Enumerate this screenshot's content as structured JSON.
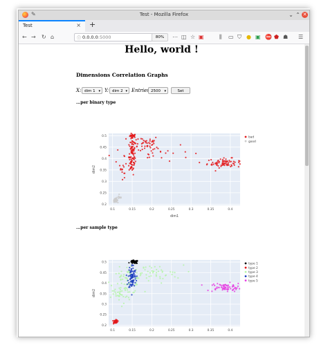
{
  "browser": {
    "window_title": "Test - Mozilla Firefox",
    "tab_label": "Test",
    "url_host": "0.0.0.0",
    "url_port": ":5000",
    "zoom": "80%"
  },
  "page": {
    "heading": "Hello, world !",
    "section_title": "Dimensions Correlation Graphs",
    "controls": {
      "x_label": "X:",
      "x_value": "dim 1",
      "y_label": "Y:",
      "y_value": "dim 2",
      "entries_label": "Entries:",
      "entries_value": "2500",
      "set_label": "Set"
    },
    "binary_heading": "...per binary type",
    "sample_heading": "...per sample type"
  },
  "chart_data": [
    {
      "type": "scatter",
      "title": "",
      "xlabel": "dim1",
      "ylabel": "dim2",
      "xlim": [
        0.09,
        0.425
      ],
      "ylim": [
        0.195,
        0.51
      ],
      "x_ticks": [
        "0.1",
        "0.15",
        "0.2",
        "0.25",
        "0.3",
        "0.35",
        "0.4"
      ],
      "y_ticks": [
        "0.2",
        "0.25",
        "0.3",
        "0.35",
        "0.4",
        "0.45",
        "0.5"
      ],
      "legend_position": "top-right",
      "series": [
        {
          "name": "bad",
          "color": "#e31a1c",
          "clusters": [
            {
              "x": 0.152,
              "y": 0.5,
              "sx": 0.004,
              "sy": 0.004,
              "n": 25
            },
            {
              "x": 0.15,
              "y": 0.41,
              "sx": 0.004,
              "sy": 0.04,
              "n": 90
            },
            {
              "x": 0.18,
              "y": 0.47,
              "sx": 0.02,
              "sy": 0.015,
              "n": 40
            },
            {
              "x": 0.2,
              "y": 0.43,
              "sx": 0.05,
              "sy": 0.02,
              "n": 35
            },
            {
              "x": 0.385,
              "y": 0.38,
              "sx": 0.022,
              "sy": 0.01,
              "n": 80
            },
            {
              "x": 0.13,
              "y": 0.36,
              "sx": 0.012,
              "sy": 0.02,
              "n": 18
            }
          ]
        },
        {
          "name": "good",
          "color": "#cccccc",
          "clusters": [
            {
              "x": 0.108,
              "y": 0.217,
              "sx": 0.0025,
              "sy": 0.004,
              "n": 70
            },
            {
              "x": 0.118,
              "y": 0.23,
              "sx": 0.003,
              "sy": 0.004,
              "n": 12
            }
          ]
        }
      ]
    },
    {
      "type": "scatter",
      "title": "",
      "xlabel": "",
      "ylabel": "dim2",
      "xlim": [
        0.09,
        0.425
      ],
      "ylim": [
        0.195,
        0.51
      ],
      "x_ticks": [
        "0.1",
        "0.15",
        "0.2",
        "0.25",
        "0.3",
        "0.35",
        "0.4"
      ],
      "y_ticks": [
        "0.2",
        "0.25",
        "0.3",
        "0.35",
        "0.4",
        "0.45",
        "0.5"
      ],
      "legend_position": "top-right",
      "series": [
        {
          "name": "type 1",
          "color": "#000000",
          "clusters": [
            {
              "x": 0.155,
              "y": 0.5,
              "sx": 0.005,
              "sy": 0.004,
              "n": 50
            }
          ]
        },
        {
          "name": "type 2",
          "color": "#e31a1c",
          "clusters": [
            {
              "x": 0.108,
              "y": 0.217,
              "sx": 0.0025,
              "sy": 0.004,
              "n": 55
            }
          ]
        },
        {
          "name": "type 3",
          "color": "#b5f5a8",
          "clusters": [
            {
              "x": 0.135,
              "y": 0.41,
              "sx": 0.02,
              "sy": 0.03,
              "n": 70
            },
            {
              "x": 0.2,
              "y": 0.445,
              "sx": 0.04,
              "sy": 0.02,
              "n": 50
            },
            {
              "x": 0.12,
              "y": 0.34,
              "sx": 0.012,
              "sy": 0.02,
              "n": 25
            }
          ]
        },
        {
          "name": "type 4",
          "color": "#1f3fbf",
          "clusters": [
            {
              "x": 0.15,
              "y": 0.43,
              "sx": 0.005,
              "sy": 0.03,
              "n": 90
            }
          ]
        },
        {
          "name": "type 5",
          "color": "#e83fe3",
          "clusters": [
            {
              "x": 0.385,
              "y": 0.38,
              "sx": 0.022,
              "sy": 0.01,
              "n": 70
            }
          ]
        }
      ]
    }
  ]
}
